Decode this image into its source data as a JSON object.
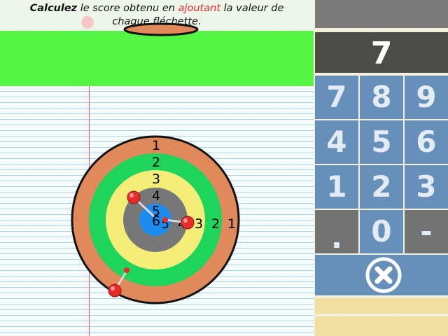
{
  "instruction": {
    "part1": "Calculez",
    "part2": " le score obtenu en ",
    "part3": "ajoutant",
    "part4": " la valeur de",
    "line2": "chaque fléchette."
  },
  "target": {
    "ring_labels_vertical": [
      "1",
      "2",
      "3",
      "4",
      "5"
    ],
    "ring_labels_horizontal": [
      "5",
      "4",
      "3",
      "2",
      "1"
    ],
    "bullseye_label": "6"
  },
  "keypad": {
    "display": "7",
    "keys": [
      {
        "label": "7",
        "name": "key-7"
      },
      {
        "label": "8",
        "name": "key-8"
      },
      {
        "label": "9",
        "name": "key-9"
      },
      {
        "label": "4",
        "name": "key-4"
      },
      {
        "label": "5",
        "name": "key-5"
      },
      {
        "label": "6",
        "name": "key-6"
      },
      {
        "label": "1",
        "name": "key-1"
      },
      {
        "label": "2",
        "name": "key-2"
      },
      {
        "label": "3",
        "name": "key-3"
      },
      {
        "label": ".",
        "name": "key-decimal"
      },
      {
        "label": "0",
        "name": "key-0"
      },
      {
        "label": "-",
        "name": "key-minus"
      }
    ],
    "clear_icon": "close-circle-icon"
  },
  "colors": {
    "ring1": "#e0895a",
    "ring2": "#1fd45a",
    "ring3": "#f4ee78",
    "ring4": "#777777",
    "bull": "#1a8cf0",
    "green_band": "#55f545",
    "key_blue": "#6690ba",
    "key_gray": "#737373"
  }
}
